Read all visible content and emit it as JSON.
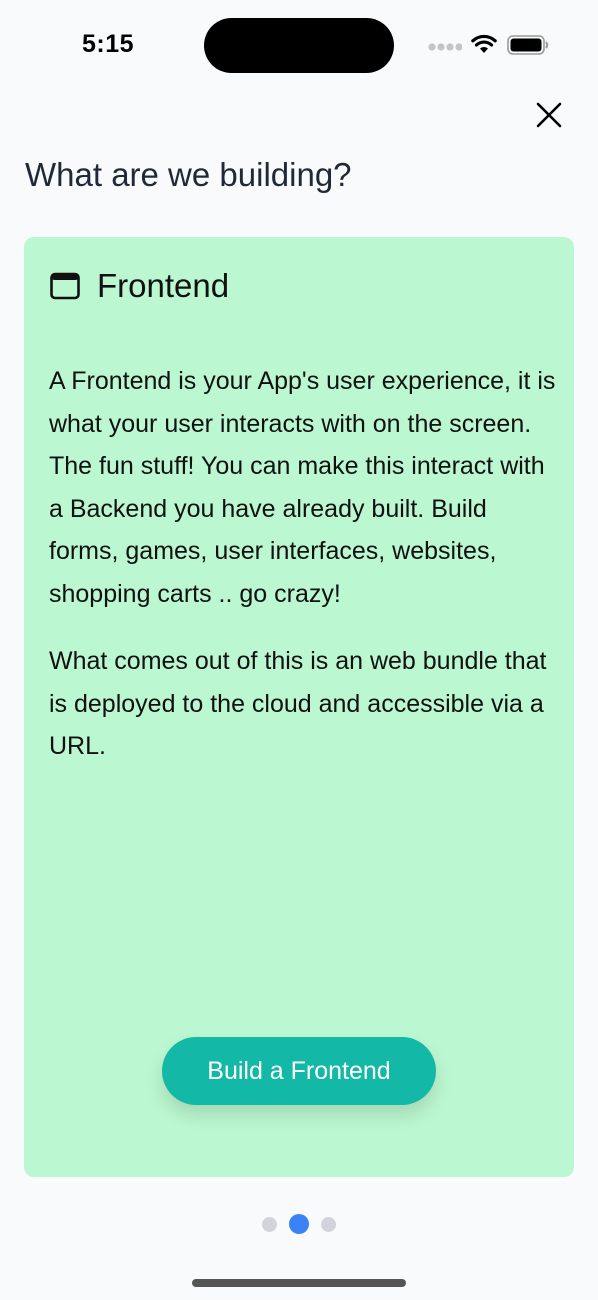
{
  "status_bar": {
    "time": "5:15",
    "icons": [
      "signal-icon",
      "wifi-icon",
      "battery-icon"
    ]
  },
  "header": {
    "close_icon": "close-icon",
    "title": "What are we building?"
  },
  "card": {
    "icon": "window-icon",
    "title": "Frontend",
    "paragraphs": [
      "A Frontend is your App's user experience, it is what your user interacts with on the screen. The fun stuff! You can make this interact with a Backend you have already built. Build forms, games, user interfaces, websites, shopping carts .. go crazy!",
      "What comes out of this is an web bundle that is deployed to the cloud and accessible via a URL."
    ],
    "button_label": "Build a Frontend",
    "background": "#bbf7d0",
    "button_color": "#14b8a6"
  },
  "pagination": {
    "total": 3,
    "active_index": 1,
    "active_color": "#3b82f6"
  }
}
